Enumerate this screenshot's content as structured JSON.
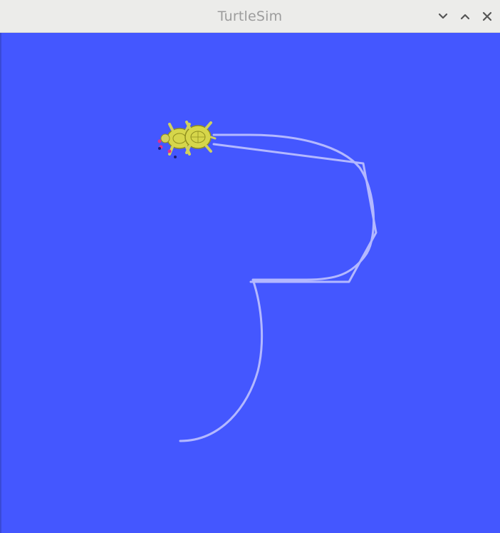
{
  "window": {
    "title": "TurtleSim",
    "background_color": "#4457ff",
    "titlebar_color": "#ececea",
    "controls": [
      {
        "name": "minimize",
        "icon": "chevron-down-icon"
      },
      {
        "name": "maximize",
        "icon": "chevron-up-icon"
      },
      {
        "name": "close",
        "icon": "close-icon"
      }
    ]
  },
  "canvas": {
    "pen_color": "#b3b8ff",
    "turtle_colors": {
      "shell": "#d6d64a",
      "shell_dark": "#8f8f1f",
      "legs": "#cfd060",
      "feet": "#e0318f"
    }
  }
}
